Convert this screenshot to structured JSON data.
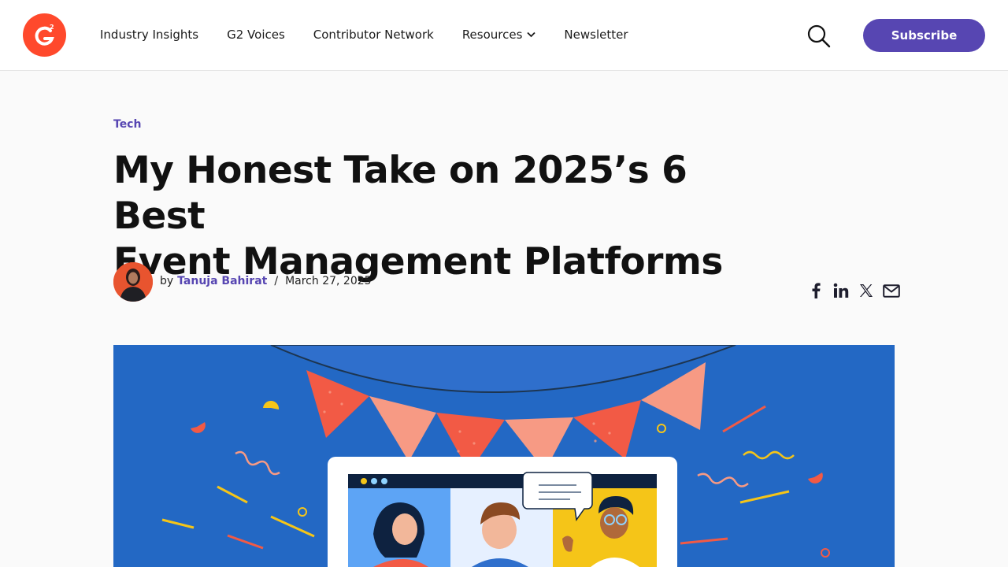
{
  "header": {
    "logo_icon": "g2-logo",
    "nav": [
      {
        "label": "Industry Insights"
      },
      {
        "label": "G2 Voices"
      },
      {
        "label": "Contributor Network"
      },
      {
        "label": "Resources",
        "has_dropdown": true
      },
      {
        "label": "Newsletter"
      }
    ],
    "search_icon": "search-icon",
    "subscribe_label": "Subscribe"
  },
  "article": {
    "category": "Tech",
    "title_line1": "My Honest Take on 2025’s 6 Best",
    "title_line2": "Event Management Platforms",
    "byline_prefix": "by",
    "author": "Tanuja Bahirat",
    "separator": "/",
    "date": "March 27, 2025",
    "share": [
      "facebook-icon",
      "linkedin-icon",
      "x-icon",
      "email-icon"
    ]
  },
  "colors": {
    "brand_red": "#ff492c",
    "accent_purple": "#5746b2",
    "hero_blue": "#2368c4",
    "bunting_salmon": "#f79a84",
    "bunting_red": "#f25a45"
  }
}
